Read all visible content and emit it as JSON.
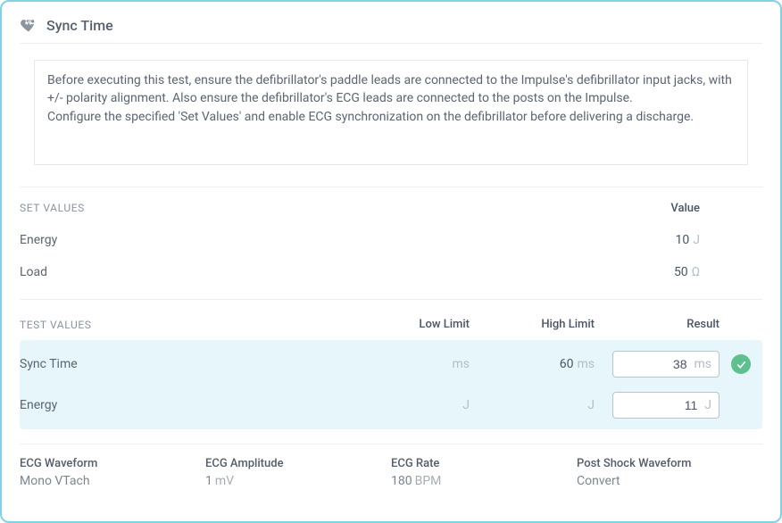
{
  "header": {
    "title": "Sync Time",
    "icon": "heartbeat-icon"
  },
  "instructions": {
    "line1": "Before executing this test, ensure the defibrillator's paddle leads are connected to the Impulse's defibrillator input jacks, with +/- polarity alignment. Also ensure the defibrillator's ECG leads are connected to the posts on the Impulse.",
    "line2": "Configure the specified 'Set Values' and enable ECG synchronization on the defibrillator before delivering a discharge."
  },
  "set_values": {
    "section_label": "Set Values",
    "value_header": "Value",
    "rows": [
      {
        "label": "Energy",
        "value": "10",
        "unit": "J"
      },
      {
        "label": "Load",
        "value": "50",
        "unit": "Ω"
      }
    ]
  },
  "test_values": {
    "section_label": "Test Values",
    "headers": {
      "low": "Low Limit",
      "high": "High Limit",
      "result": "Result"
    },
    "rows": [
      {
        "name": "Sync Time",
        "low": "",
        "low_unit": "ms",
        "high": "60",
        "high_unit": "ms",
        "result": "38",
        "result_unit": "ms",
        "status": "pass"
      },
      {
        "name": "Energy",
        "low": "",
        "low_unit": "J",
        "high": "",
        "high_unit": "J",
        "result": "11",
        "result_unit": "J",
        "status": ""
      }
    ]
  },
  "footer": {
    "cols": [
      {
        "label": "ECG Waveform",
        "value": "Mono VTach",
        "unit": ""
      },
      {
        "label": "ECG Amplitude",
        "value": "1",
        "unit": "mV"
      },
      {
        "label": "ECG Rate",
        "value": "180",
        "unit": "BPM"
      },
      {
        "label": "Post Shock Waveform",
        "value": "Convert",
        "unit": ""
      }
    ]
  },
  "colors": {
    "card_border": "#7fd3e6",
    "highlight_bg": "#e7f6fa",
    "pass_green": "#5ec08e"
  }
}
